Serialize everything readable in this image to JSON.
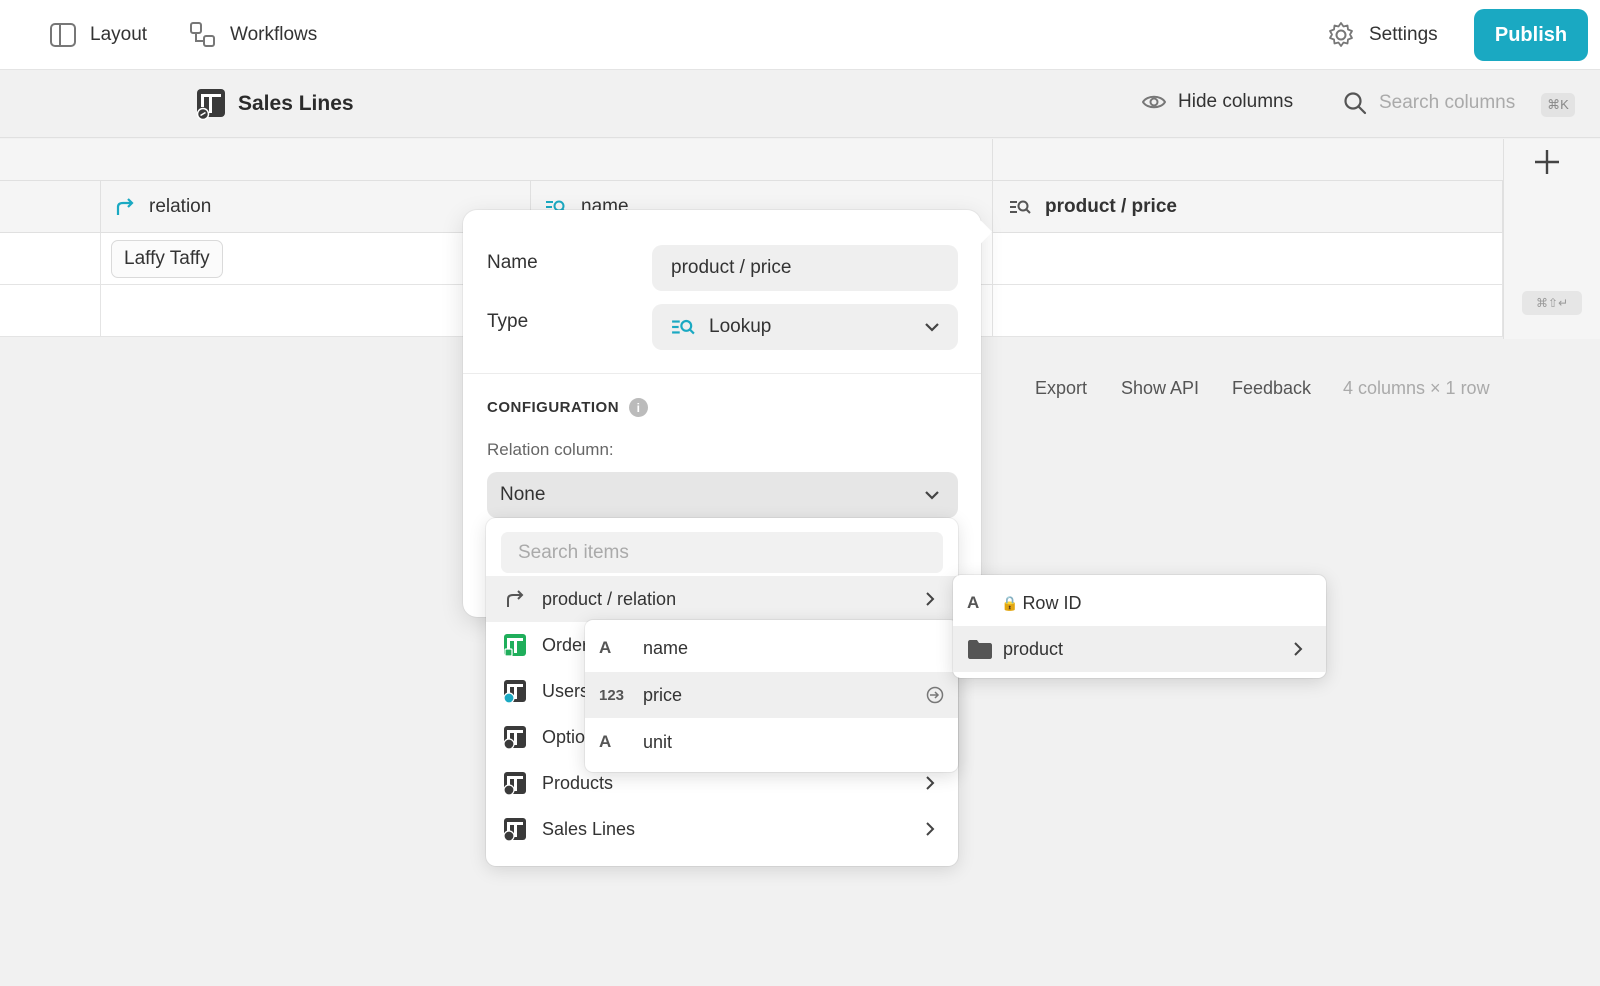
{
  "topbar": {
    "layout_label": "Layout",
    "workflows_label": "Workflows",
    "settings_label": "Settings",
    "publish_label": "Publish"
  },
  "toolbar": {
    "table_title": "Sales Lines",
    "hide_columns_label": "Hide columns",
    "search_placeholder": "Search columns",
    "shortcut": "⌘K"
  },
  "grid": {
    "columns": [
      {
        "label": "relation",
        "icon": "relation-arrow-icon"
      },
      {
        "label": "name",
        "icon": "lookup-icon"
      },
      {
        "label": "product / price",
        "icon": "lookup-icon"
      }
    ],
    "rows": [
      {
        "relation": "Laffy Taffy"
      }
    ],
    "add_shortcut": "⌘⇧↵"
  },
  "footer": {
    "export": "Export",
    "show_api": "Show API",
    "feedback": "Feedback",
    "summary": "4 columns × 1 row"
  },
  "popover": {
    "name_label": "Name",
    "name_value": "product / price",
    "type_label": "Type",
    "type_value": "Lookup",
    "config_heading": "CONFIGURATION",
    "info_glyph": "i",
    "relation_label": "Relation column:",
    "relation_value": "None"
  },
  "dropdown": {
    "search_placeholder": "Search items",
    "items": [
      {
        "label": "product / relation",
        "icon": "relation-arrow-icon"
      },
      {
        "label": "Orders",
        "icon": "table-green-icon"
      },
      {
        "label": "Users",
        "icon": "table-users-icon"
      },
      {
        "label": "Options",
        "icon": "table-icon"
      },
      {
        "label": "Products",
        "icon": "table-icon"
      },
      {
        "label": "Sales Lines",
        "icon": "table-icon"
      }
    ]
  },
  "fields_submenu": {
    "items": [
      {
        "label": "name",
        "type_glyph": "A"
      },
      {
        "label": "price",
        "type_glyph": "123"
      },
      {
        "label": "unit",
        "type_glyph": "A"
      }
    ]
  },
  "relation_submenu": {
    "items": [
      {
        "label": "Row ID",
        "type_glyph": "A",
        "lock_glyph": "🔒"
      },
      {
        "label": "product",
        "icon": "folder-icon"
      }
    ]
  },
  "colors": {
    "accent": "#1aa9c2",
    "green_table": "#1fae5b"
  }
}
